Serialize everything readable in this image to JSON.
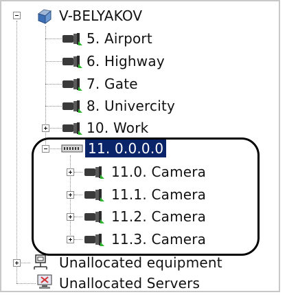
{
  "tree": {
    "root": {
      "label": "V-BELYAKOV",
      "icon": "server-cube-icon"
    },
    "cameras": [
      {
        "label": "5. Airport",
        "icon": "camera-icon"
      },
      {
        "label": "6. Highway",
        "icon": "camera-icon"
      },
      {
        "label": "7. Gate",
        "icon": "camera-icon"
      },
      {
        "label": "8. Univercity",
        "icon": "camera-icon"
      },
      {
        "label": "10. Work",
        "icon": "camera-icon"
      }
    ],
    "device": {
      "label": "11. 0.0.0.0",
      "icon": "video-encoder-icon"
    },
    "device_cameras": [
      {
        "label": "11.0. Camera",
        "icon": "camera-icon"
      },
      {
        "label": "11.1. Camera",
        "icon": "camera-icon"
      },
      {
        "label": "11.2. Camera",
        "icon": "camera-icon"
      },
      {
        "label": "11.3. Camera",
        "icon": "camera-icon"
      }
    ],
    "unallocated_equipment": {
      "label": "Unallocated equipment",
      "icon": "network-equipment-icon"
    },
    "unallocated_servers": {
      "label": "Unallocated Servers",
      "icon": "server-monitor-icon"
    }
  },
  "colors": {
    "selection": "#0a246a",
    "camera_indicator": "#2db52d",
    "highlight_outline": "#000000"
  }
}
